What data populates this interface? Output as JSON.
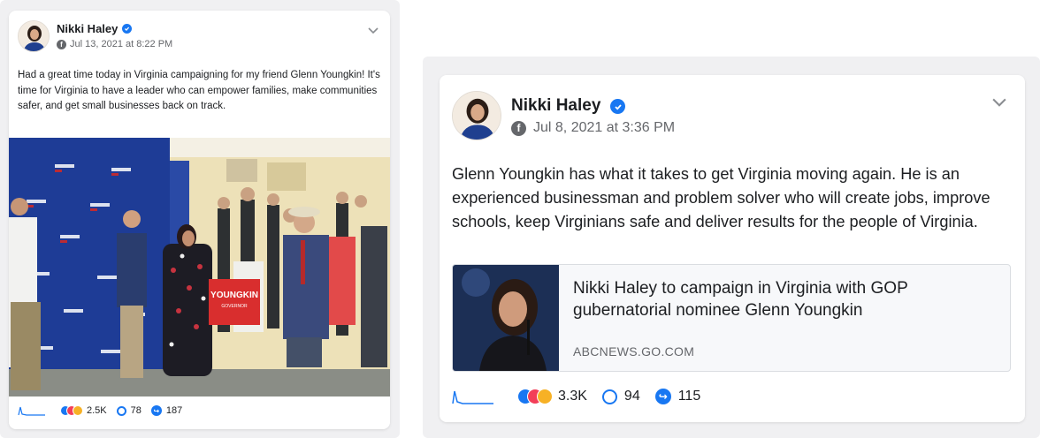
{
  "posts": [
    {
      "author": "Nikki Haley",
      "date": "Jul 13, 2021 at 8:22 PM",
      "text": "Had a great time today in Virginia campaigning for my friend Glenn Youngkin! It's time for Virginia to have a leader who can empower families, make communities safer, and get small businesses back on track.",
      "photo_sign": "YOUNGKIN",
      "photo_sign_sub": "GOVERNOR",
      "reactions": "2.5K",
      "comments": "78",
      "shares": "187"
    },
    {
      "author": "Nikki Haley",
      "date": "Jul 8, 2021 at 3:36 PM",
      "text": "Glenn Youngkin has what it takes to get Virginia moving again. He is an experienced businessman and problem solver who will create jobs, improve schools, keep Virginians safe and deliver results for the people of Virginia.",
      "link_title": "Nikki Haley to campaign in Virginia with GOP gubernatorial nominee Glenn Youngkin",
      "link_domain": "ABCNEWS.GO.COM",
      "reactions": "3.3K",
      "comments": "94",
      "shares": "115"
    }
  ],
  "icons": {
    "verified": "verified-badge-icon",
    "globe": "facebook-icon",
    "more": "chevron-down-icon",
    "comment": "comment-bubble-icon",
    "share": "share-icon"
  },
  "colors": {
    "accent": "#1877f2",
    "meta": "#65676b",
    "text": "#1c1e21"
  }
}
